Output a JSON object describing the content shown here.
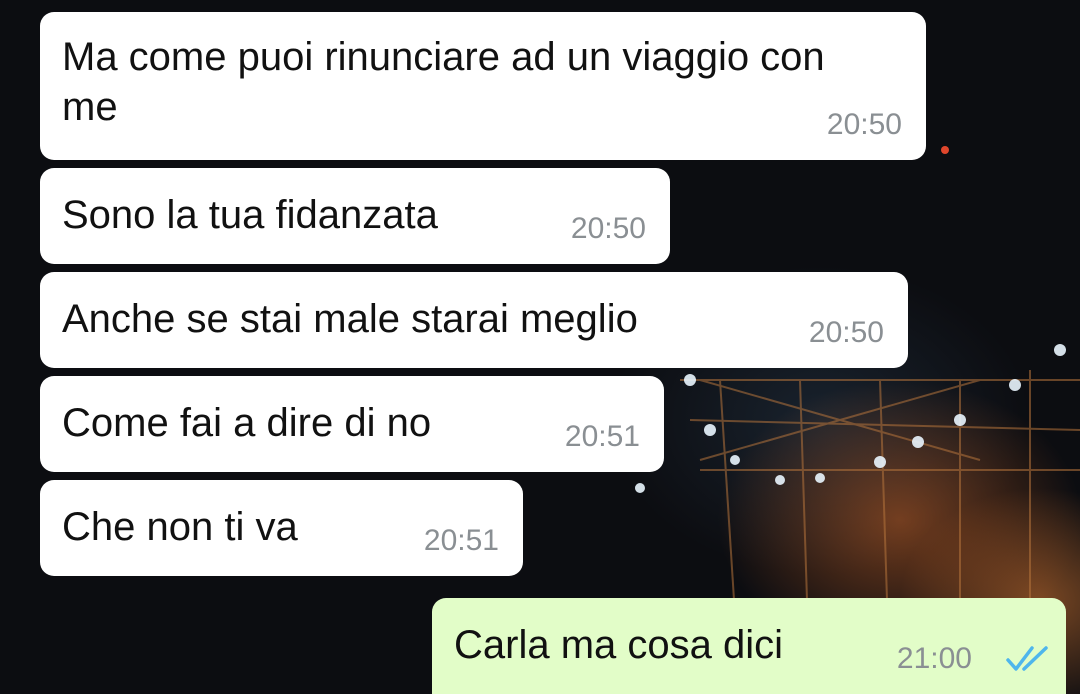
{
  "messages": [
    {
      "text": "Ma come puoi rinunciare ad un viaggio con\nme",
      "time": "20:50",
      "direction": "incoming"
    },
    {
      "text": "Sono la tua fidanzata",
      "time": "20:50",
      "direction": "incoming"
    },
    {
      "text": "Anche se stai male starai meglio",
      "time": "20:50",
      "direction": "incoming"
    },
    {
      "text": "Come fai a dire di no",
      "time": "20:51",
      "direction": "incoming"
    },
    {
      "text": "Che non ti va",
      "time": "20:51",
      "direction": "incoming"
    },
    {
      "text": "Carla ma cosa dici",
      "time": "21:00",
      "direction": "outgoing",
      "status_icon": "double-check-read-icon"
    }
  ],
  "colors": {
    "incoming_bubble": "#ffffff",
    "outgoing_bubble": "#e2fdc8",
    "read_ticks": "#4fb6ec",
    "timestamp": "#8a8f93"
  }
}
